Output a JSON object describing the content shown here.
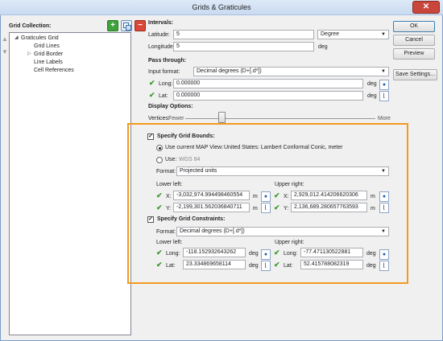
{
  "window": {
    "title": "Grids & Graticules",
    "close_glyph": "✕"
  },
  "grid_collection": {
    "label": "Grid Collection:",
    "tree": {
      "root": "Graticules Grid",
      "children": [
        "Grid Lines",
        "Grid Border",
        "Line Labels",
        "Cell References"
      ]
    }
  },
  "intervals": {
    "heading": "Intervals:",
    "latitude_label": "Latitude:",
    "latitude_value": "5",
    "unit_select": "Degree",
    "longitude_label": "Longitude:",
    "longitude_value": "5",
    "longitude_unit": "deg"
  },
  "pass_through": {
    "heading": "Pass through:",
    "input_format_label": "Input format:",
    "input_format_value": "Decimal degrees (D+[.d*])",
    "long_label": "Long:",
    "long_value": "0.000000",
    "lat_label": "Lat:",
    "lat_value": "0.000000",
    "unit": "deg"
  },
  "display_options": {
    "heading": "Display Options:",
    "vertices_label": "Vertices:",
    "fewer": "Fewer",
    "more": "More"
  },
  "grid_bounds": {
    "heading": "Specify Grid Bounds:",
    "checked": true,
    "use_map_view_label": "Use current MAP View:",
    "map_view_value": "United States: Lambert Conformal Conic, meter",
    "use_label": "Use:",
    "use_value": "WGS 84",
    "format_label": "Format:",
    "format_value": "Projected units",
    "lower_left_label": "Lower left:",
    "upper_right_label": "Upper right:",
    "ll_x_label": "X:",
    "ll_x_value": "-3,032,974.994498460554",
    "ll_y_label": "Y:",
    "ll_y_value": "-2,199,301.562036840711",
    "ur_x_label": "X:",
    "ur_x_value": "2,929,012.414206620306",
    "ur_y_label": "Y:",
    "ur_y_value": "2,136,689.280657763593",
    "unit": "m"
  },
  "grid_constraints": {
    "heading": "Specify Grid Constraints:",
    "checked": true,
    "format_label": "Format:",
    "format_value": "Decimal degrees (D+[.d*])",
    "lower_left_label": "Lower left:",
    "upper_right_label": "Upper right:",
    "ll_long_label": "Long:",
    "ll_long_value": "-118.152932643262",
    "ll_lat_label": "Lat:",
    "ll_lat_value": "23.334869658114",
    "ur_long_label": "Long:",
    "ur_long_value": "-77.471130522881",
    "ur_lat_label": "Lat:",
    "ur_lat_value": "52.415788082319",
    "unit": "deg"
  },
  "buttons": {
    "ok": "OK",
    "cancel": "Cancel",
    "preview": "Preview",
    "save_settings": "Save Settings..."
  },
  "colors": {
    "highlight": "#f39a1e",
    "check": "#3c9b2c",
    "add_tool": "#3ea33a",
    "remove_tool": "#d9473a"
  }
}
